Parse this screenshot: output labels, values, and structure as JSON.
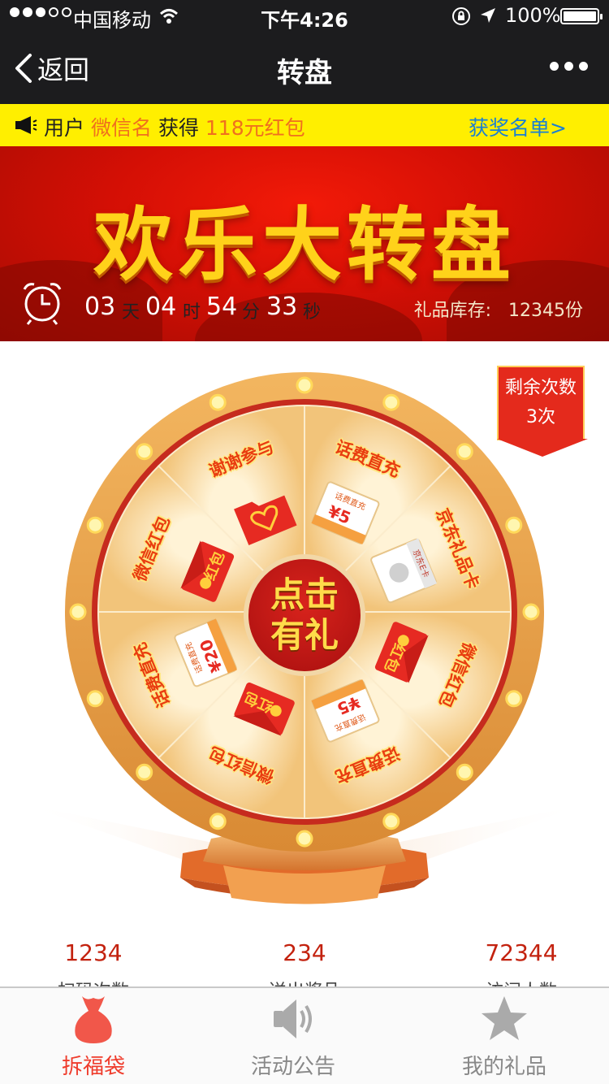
{
  "status_bar": {
    "carrier": "中国移动",
    "time": "下午4:26",
    "battery": "100%"
  },
  "nav": {
    "back_label": "返回",
    "title": "转盘"
  },
  "notice": {
    "prefix": "用户",
    "user": "微信名",
    "verb": "获得",
    "prize": "118元红包",
    "winners_link": "获奖名单>"
  },
  "banner": {
    "headline": "欢乐大转盘",
    "countdown": {
      "days": "03",
      "days_unit": "天",
      "hours": "04",
      "hours_unit": "时",
      "minutes": "54",
      "minutes_unit": "分",
      "seconds": "33",
      "seconds_unit": "秒"
    },
    "stock_label": "礼品库存:",
    "stock_value": "12345份"
  },
  "remaining": {
    "label": "剩余次数",
    "count": "3次"
  },
  "wheel": {
    "center_line1": "点击",
    "center_line2": "有礼",
    "segments": [
      {
        "label": "话费直充",
        "icon": "recharge-card-icon",
        "card_text": "话费直充",
        "value": "¥5"
      },
      {
        "label": "京东礼品卡",
        "icon": "jd-gift-card-icon",
        "card_text": "京东E卡"
      },
      {
        "label": "微信红包",
        "icon": "red-envelope-icon",
        "card_text": "红包"
      },
      {
        "label": "话费直充",
        "icon": "recharge-card-icon",
        "card_text": "话费直充",
        "value": "¥5"
      },
      {
        "label": "微信红包",
        "icon": "red-envelope-icon",
        "card_text": "红包"
      },
      {
        "label": "话费直充",
        "icon": "recharge-card-icon",
        "card_text": "话费直充",
        "value": "¥20"
      },
      {
        "label": "微信红包",
        "icon": "red-envelope-icon",
        "card_text": "红包"
      },
      {
        "label": "谢谢参与",
        "icon": "heart-folder-icon"
      }
    ],
    "colors": {
      "rim": "#e8a04a",
      "inner_ring": "#c62b1e",
      "segment_light": "#fcebc2",
      "segment_dark": "#f3c983",
      "bulb": "#fff6b0"
    }
  },
  "stats": [
    {
      "value": "1234",
      "label": "扫码次数"
    },
    {
      "value": "234",
      "label": "送出奖品"
    },
    {
      "value": "72344",
      "label": "访问人数"
    }
  ],
  "tabs": [
    {
      "label": "拆福袋",
      "icon": "lucky-bag-icon",
      "active": true
    },
    {
      "label": "活动公告",
      "icon": "speaker-icon",
      "active": false
    },
    {
      "label": "我的礼品",
      "icon": "star-icon",
      "active": false
    }
  ],
  "colors": {
    "accent": "#ef3c2c",
    "notice_bg": "#ffef00",
    "link": "#1a7fd4",
    "headline": "#ffd21a"
  }
}
